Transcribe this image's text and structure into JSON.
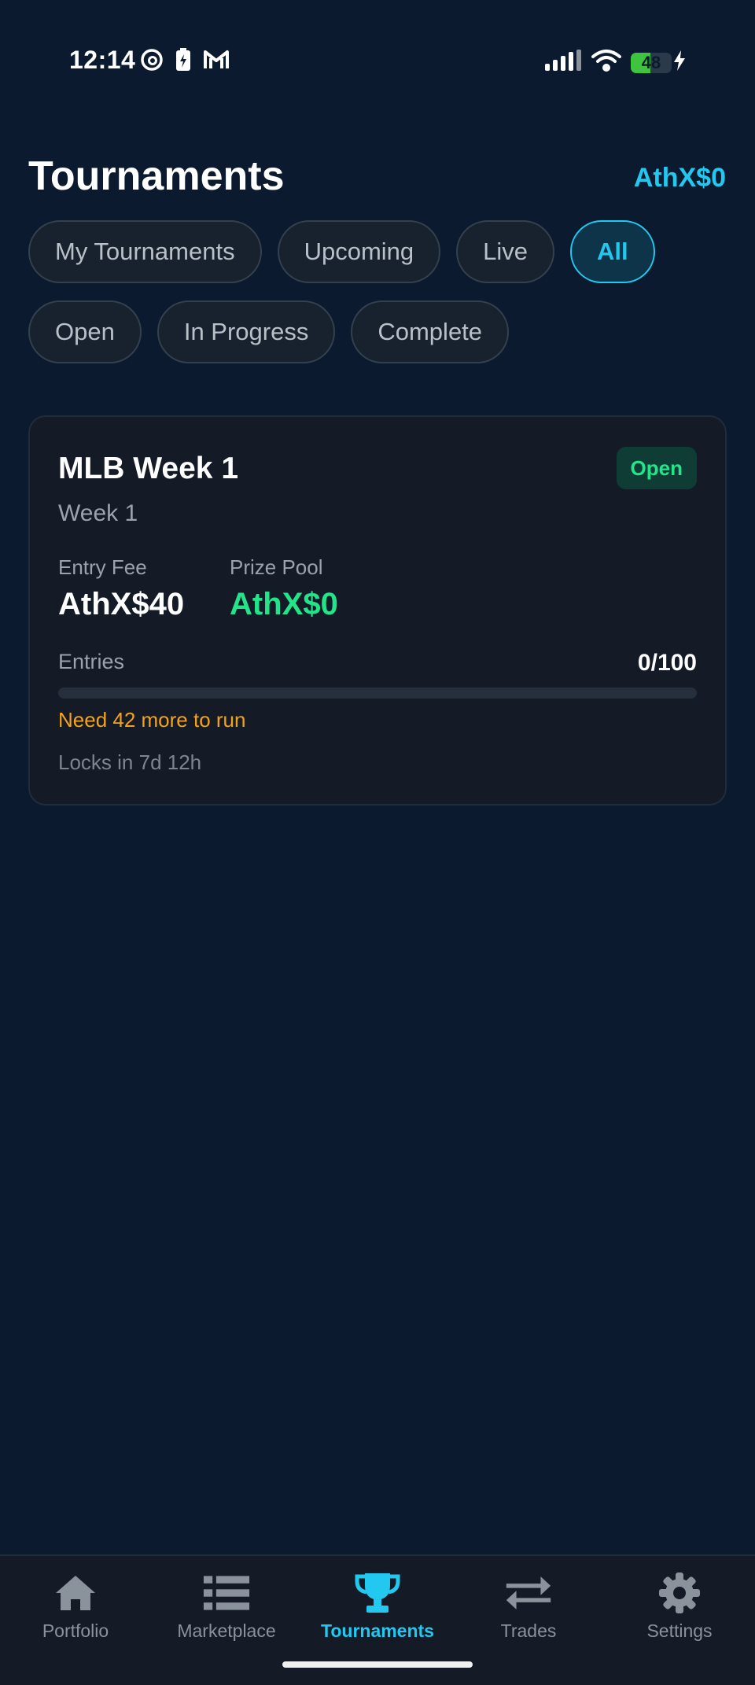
{
  "status_bar": {
    "time": "12:14",
    "battery_level": "48",
    "battery_fraction": 0.48,
    "icons": [
      "threads-icon",
      "battery-saver-icon",
      "gmail-icon",
      "signal-icon",
      "wifi-icon",
      "battery-icon",
      "charging-icon"
    ]
  },
  "header": {
    "title": "Tournaments",
    "balance": "AthX$0"
  },
  "filters": {
    "row1": [
      "My Tournaments",
      "Upcoming",
      "Live",
      "All"
    ],
    "row2": [
      "Open",
      "In Progress",
      "Complete"
    ],
    "active": "All"
  },
  "tournament": {
    "title": "MLB Week 1",
    "subtitle": "Week 1",
    "status": "Open",
    "entry_fee_label": "Entry Fee",
    "entry_fee": "AthX$40",
    "prize_pool_label": "Prize Pool",
    "prize_pool": "AthX$0",
    "entries_label": "Entries",
    "entries_count": "0/100",
    "entries_fraction": 0,
    "need_more": "Need 42 more to run",
    "locks_in": "Locks in 7d 12h"
  },
  "nav": {
    "items": [
      {
        "label": "Portfolio",
        "icon": "home-icon"
      },
      {
        "label": "Marketplace",
        "icon": "list-icon"
      },
      {
        "label": "Tournaments",
        "icon": "trophy-icon"
      },
      {
        "label": "Trades",
        "icon": "swap-arrows-icon"
      },
      {
        "label": "Settings",
        "icon": "gear-icon"
      }
    ],
    "active": "Tournaments"
  },
  "colors": {
    "background": "#0b1a2e",
    "accent": "#22c8f0",
    "success": "#22e58a",
    "warning": "#f5a21b",
    "card": "#141b26"
  }
}
